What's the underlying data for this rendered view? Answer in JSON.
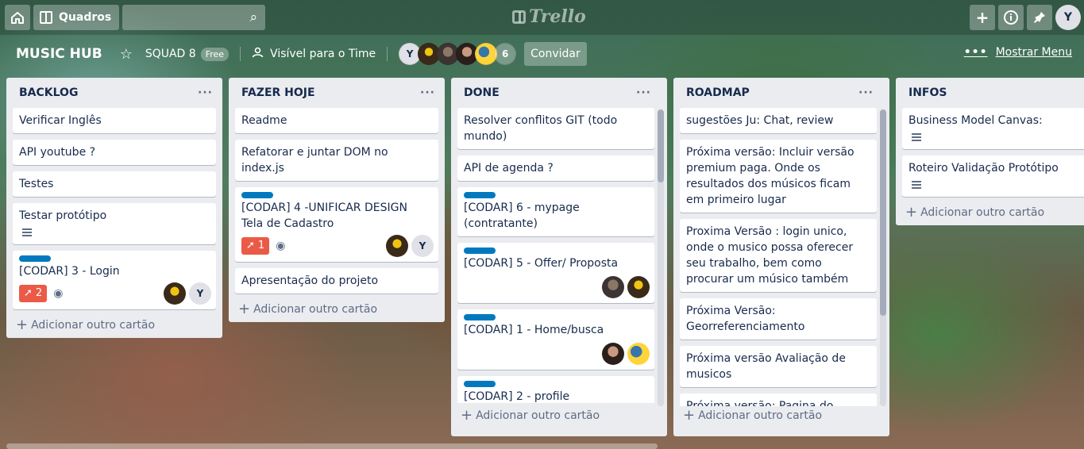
{
  "topbar": {
    "home_icon": "home-icon",
    "boards_label": "Quadros",
    "search_placeholder": "",
    "logo_text": "Trello",
    "icons": [
      "plus-icon",
      "info-icon",
      "notification-icon"
    ],
    "user_initial": "Y"
  },
  "board": {
    "title": "MUSIC HUB",
    "team": "SQUAD 8",
    "plan": "Free",
    "visibility": "Visível para o Time",
    "member_initial": "Y",
    "member_count": "6",
    "invite_label": "Convidar",
    "menu_label": "Mostrar Menu"
  },
  "lists": [
    {
      "title": "BACKLOG",
      "cards": [
        {
          "text": "Verificar Inglês"
        },
        {
          "text": "API youtube ?"
        },
        {
          "text": "Testes"
        },
        {
          "text": "Testar protótipo"
        },
        {
          "text": "[CODAR] 3 - Login",
          "pin_count": "2"
        }
      ],
      "add_label": "Adicionar outro cartão"
    },
    {
      "title": "FAZER HOJE",
      "cards": [
        {
          "text": "Readme"
        },
        {
          "text": "Refatorar e juntar DOM no index.js"
        },
        {
          "text": "[CODAR] 4 -UNIFICAR DESIGN Tela de Cadastro",
          "pin_count": "1"
        },
        {
          "text": "Apresentação do projeto"
        }
      ],
      "add_label": "Adicionar outro cartão"
    },
    {
      "title": "DONE",
      "cards": [
        {
          "text": "Resolver conflitos GIT (todo mundo)"
        },
        {
          "text": "API de agenda ?"
        },
        {
          "text": "[CODAR] 6 - mypage (contratante)"
        },
        {
          "text": "[CODAR] 5 - Offer/ Proposta"
        },
        {
          "text": "[CODAR] 1 - Home/busca"
        },
        {
          "text": "[CODAR] 2 - profile"
        }
      ],
      "add_label": "Adicionar outro cartão"
    },
    {
      "title": "ROADMAP",
      "cards": [
        {
          "text": "sugestões Ju: Chat, review"
        },
        {
          "text": "Próxima versão: Incluir versão premium paga. Onde os resultados dos músicos ficam em primeiro lugar"
        },
        {
          "text": "Proxima Versão : login unico, onde o musico possa oferecer seu trabalho, bem como procurar um músico também"
        },
        {
          "text": "Próxima Versão: Georreferenciamento"
        },
        {
          "text": "Próxima versão Avaliação de musicos"
        },
        {
          "text": "Próxima versão: Pagina do musico"
        }
      ],
      "add_label": "Adicionar outro cartão"
    },
    {
      "title": "INFOS",
      "cards": [
        {
          "text": "Business Model Canvas:"
        },
        {
          "text": "Roteiro Validação Protótipo"
        }
      ],
      "add_label": "Adicionar outro cartão"
    }
  ],
  "colors": {
    "label_blue": "#0079bf",
    "badge_red": "#eb5a46",
    "list_bg": "#ebecf0"
  },
  "member_initial_small": "Y"
}
